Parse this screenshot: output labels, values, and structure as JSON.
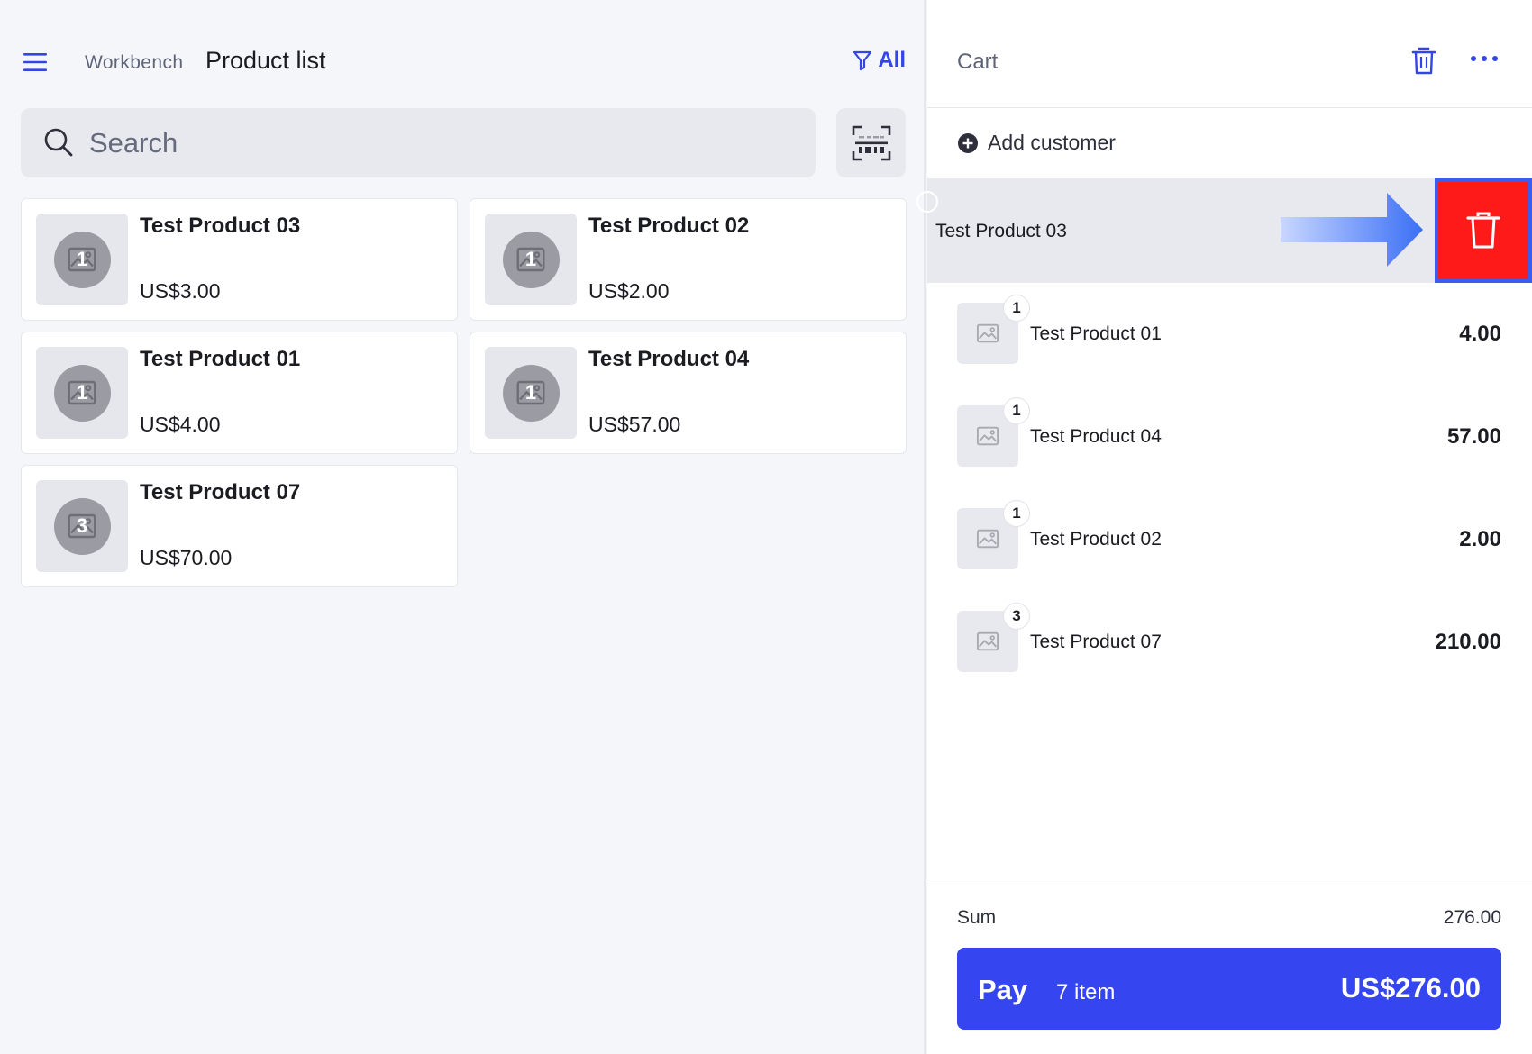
{
  "header": {
    "breadcrumb": "Workbench",
    "title": "Product list",
    "filter_label": "All"
  },
  "search": {
    "placeholder": "Search"
  },
  "products": [
    {
      "name": "Test Product 03",
      "price": "US$3.00",
      "badge": "1"
    },
    {
      "name": "Test Product 02",
      "price": "US$2.00",
      "badge": "1"
    },
    {
      "name": "Test Product 01",
      "price": "US$4.00",
      "badge": "1"
    },
    {
      "name": "Test Product 04",
      "price": "US$57.00",
      "badge": "1"
    },
    {
      "name": "Test Product 07",
      "price": "US$70.00",
      "badge": "3"
    }
  ],
  "cart": {
    "title": "Cart",
    "add_customer_label": "Add customer",
    "swiped_item": {
      "name": "Test Product 03"
    },
    "items": [
      {
        "name": "Test Product 01",
        "qty": "1",
        "total": "4.00"
      },
      {
        "name": "Test Product 04",
        "qty": "1",
        "total": "57.00"
      },
      {
        "name": "Test Product 02",
        "qty": "1",
        "total": "2.00"
      },
      {
        "name": "Test Product 07",
        "qty": "3",
        "total": "210.00"
      }
    ],
    "sum_label": "Sum",
    "sum_value": "276.00",
    "pay": {
      "label": "Pay",
      "count": "7 item",
      "amount": "US$276.00"
    }
  },
  "colors": {
    "accent": "#3546f0",
    "delete": "#ff1a1a",
    "highlight_outline": "#3a5df0"
  }
}
